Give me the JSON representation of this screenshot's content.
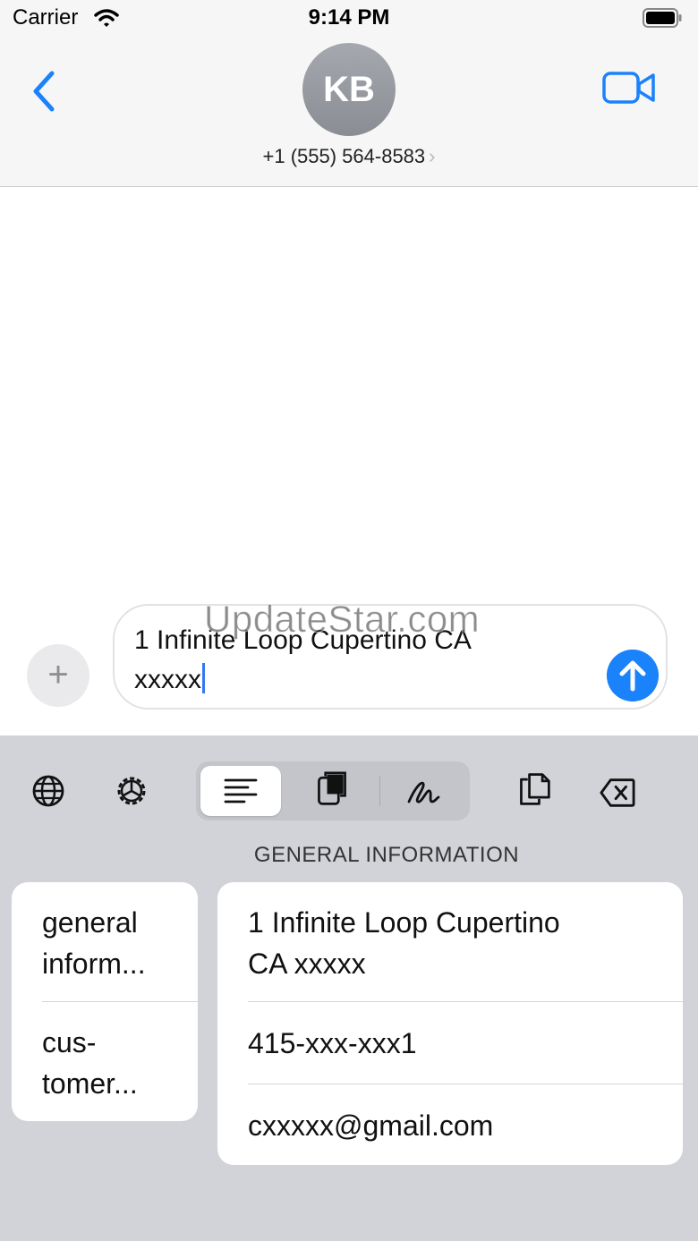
{
  "status_bar": {
    "carrier": "Carrier",
    "time": "9:14 PM"
  },
  "header": {
    "avatar_initials": "KB",
    "contact": "+1 (555) 564-8583",
    "chevron": "›",
    "icons": {
      "back": "chevron-left-icon",
      "video": "video-camera-icon"
    }
  },
  "composer": {
    "plus": "+",
    "text_line1": "1 Infinite Loop Cupertino CA",
    "text_line2": "xxxxx",
    "watermark": "UpdateStar.com"
  },
  "keyboard": {
    "toolbar_icons": [
      "globe-icon",
      "settings-icon",
      "text-align-icon",
      "clipboard-icon",
      "signature-icon",
      "copy-icon",
      "delete-icon"
    ],
    "section_title": "GENERAL INFORMATION",
    "categories": [
      {
        "line1": "general",
        "line2": "inform..."
      },
      {
        "line1": "cus-",
        "line2": "tomer..."
      }
    ],
    "items": [
      {
        "line1": "1 Infinite Loop Cupertino",
        "line2": "CA xxxxx"
      },
      {
        "line1": "415-xxx-xxx1"
      },
      {
        "line1": "cxxxxx@gmail.com"
      }
    ]
  },
  "colors": {
    "accent": "#1a82fb",
    "keyboard_bg": "#d1d3d9",
    "header_bg": "#f6f6f6"
  }
}
